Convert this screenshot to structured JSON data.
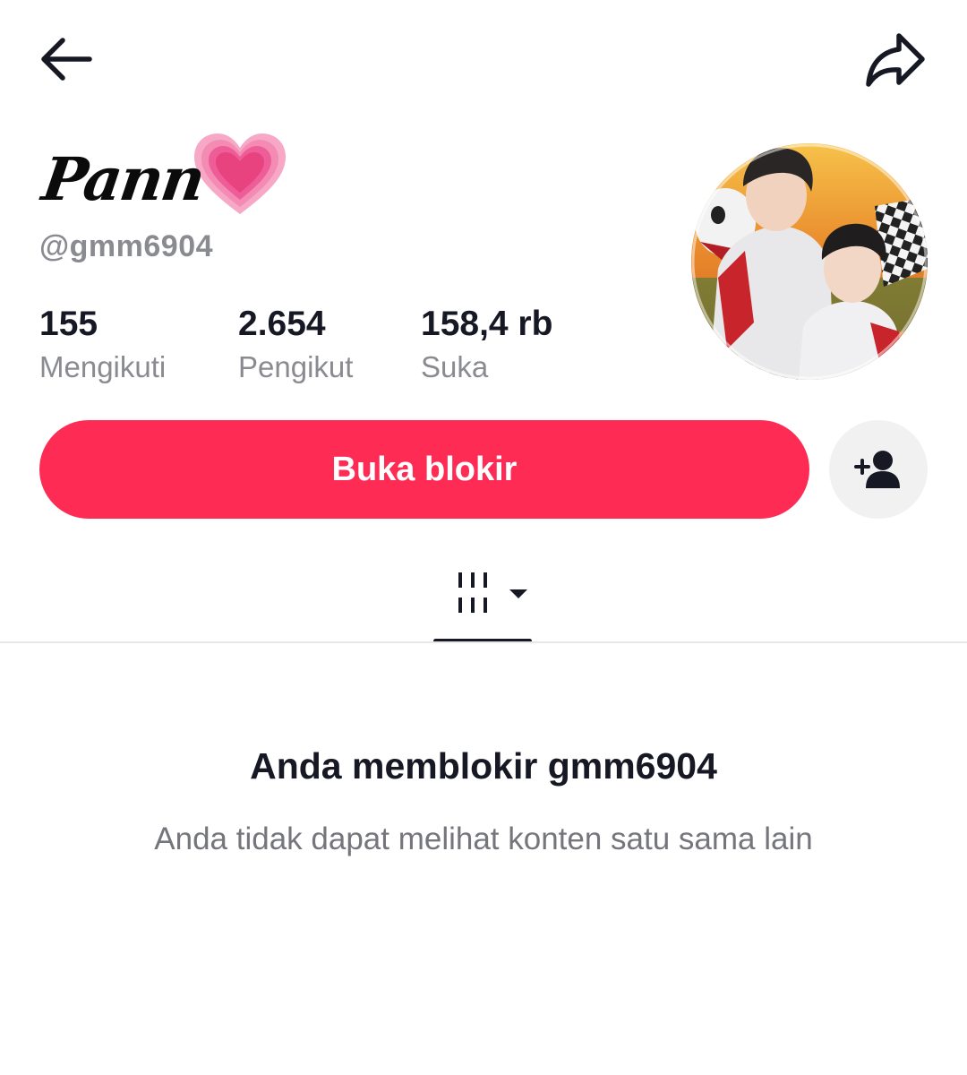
{
  "profile": {
    "display_name": "Pann",
    "display_emoji": "heart-icon",
    "username": "@gmm6904",
    "avatar": "avatar-photo"
  },
  "stats": {
    "following_value": "155",
    "following_label": "Mengikuti",
    "followers_value": "2.654",
    "followers_label": "Pengikut",
    "likes_value": "158,4 rb",
    "likes_label": "Suka"
  },
  "actions": {
    "unblock_label": "Buka blokir",
    "add_friend_icon": "add-user-icon"
  },
  "tabs": {
    "active": "videos-grid-icon"
  },
  "empty_state": {
    "title": "Anda memblokir gmm6904",
    "description": "Anda tidak dapat melihat konten satu sama lain"
  },
  "colors": {
    "accent": "#fe2c55",
    "text_primary": "#161823",
    "text_secondary": "#8a8b91",
    "button_secondary_bg": "#f1f1f2"
  }
}
